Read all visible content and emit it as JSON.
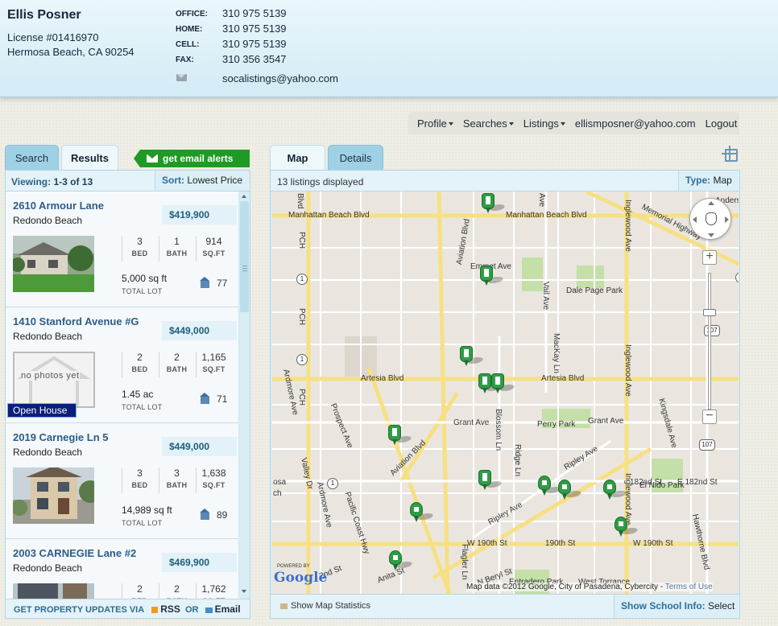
{
  "header": {
    "agent_name": "Ellis Posner",
    "license": "License #01416970",
    "location": "Hermosa Beach, CA 90254",
    "contacts": [
      {
        "label": "OFFICE:",
        "value": "310 975 5139"
      },
      {
        "label": "HOME:",
        "value": "310 975 5139"
      },
      {
        "label": "CELL:",
        "value": "310 975 5139"
      },
      {
        "label": "FAX:",
        "value": "310 356 3547"
      }
    ],
    "email": "socalistings@yahoo.com"
  },
  "nav": {
    "profile": "Profile",
    "searches": "Searches",
    "listings": "Listings",
    "user_email": "ellismposner@yahoo.com",
    "logout": "Logout"
  },
  "left_tabs": {
    "search": "Search",
    "results": "Results"
  },
  "alerts_button": "get email alerts",
  "results": {
    "viewing_label": "Viewing:",
    "viewing_range": "1-3 of 13",
    "sort_label": "Sort:",
    "sort_value": "Lowest Price",
    "bed_label": "BED",
    "bath_label": "BATH",
    "sqft_label": "SQ.FT",
    "lot_label": "TOTAL LOT",
    "no_photo": "no photos yet",
    "open_house": "Open House",
    "items": [
      {
        "address": "2610 Armour Lane",
        "city": "Redondo Beach",
        "price": "$419,900",
        "beds": "3",
        "baths": "1",
        "sqft": "914",
        "lot": "5,000 sq ft",
        "school": "77"
      },
      {
        "address": "1410 Stanford Avenue #G",
        "city": "Redondo Beach",
        "price": "$449,000",
        "beds": "2",
        "baths": "2",
        "sqft": "1,165",
        "lot": "1.45 ac",
        "school": "71"
      },
      {
        "address": "2019 Carnegie Ln 5",
        "city": "Redondo Beach",
        "price": "$449,000",
        "beds": "3",
        "baths": "3",
        "sqft": "1,638",
        "lot": "14,989 sq ft",
        "school": "89"
      },
      {
        "address": "2003 CARNEGIE Lane #2",
        "city": "Redondo Beach",
        "price": "$469,900",
        "beds": "2",
        "baths": "2",
        "sqft": "1,762",
        "lot": "",
        "school": ""
      }
    ],
    "footer": {
      "updates": "GET PROPERTY UPDATES VIA",
      "rss": "RSS",
      "or": "OR",
      "email": "Email"
    }
  },
  "right_tabs": {
    "map": "Map",
    "details": "Details"
  },
  "map_panel": {
    "listings_count": "13 listings displayed",
    "type_label": "Type:",
    "type_value": "Map",
    "attribution": "Map data ©2012 Google, City of Pasadena, Cybercity -",
    "terms": "Terms of Use",
    "powered": "POWERED BY",
    "google": "Google",
    "stats_link": "Show Map Statistics",
    "school_label": "Show School Info:",
    "school_value": "Select",
    "streets": {
      "manhattan": "Manhattan Beach Blvd",
      "manhattan2": "Manhattan Beach Blvd",
      "artesia": "Artesia Blvd",
      "artesia2": "Artesia Blvd",
      "grant": "Grant Ave",
      "grant2": "Grant Ave",
      "ripley": "Ripley Ave",
      "ripley2": "Ripley Ave",
      "w190": "W 190th St",
      "190": "190th St",
      "w190b": "W 190th St",
      "182": "182nd St",
      "e182": "E 182nd St",
      "aviation": "Aviation Blvd",
      "aviation2": "Aviation Blvd",
      "inglewood": "Inglewood Ave",
      "inglewood2": "Inglewood Ave",
      "inglewood3": "Inglewood Ave",
      "prospect": "Prospect Ave",
      "pch": "PCH",
      "pch2": "PCH",
      "pch3": "PCH",
      "pacific": "Pacific Coast Hwy",
      "ardmore": "Ardmore Ave",
      "ardmore2": "Ardmore Ave",
      "valley": "Valley Dr",
      "blossom": "Blossom Ln",
      "ridge": "Ridge Ln",
      "mackay": "MacKay Ln",
      "vail": "Vail Ave",
      "kingsdale": "Kingsdale Ave",
      "hawthorne": "Hawthorne Blvd",
      "flagler": "Flagler Ln",
      "nberyl": "N Beryl St",
      "anita": "Anita St",
      "2nd": "2nd St",
      "emmet": "Emmet Ave",
      "memorial": "Memorial Highway",
      "anders": "Anders",
      "blvd": "Blvd",
      "ave": "Ave",
      "osa": "osa",
      "ch": "ch",
      "dale_page": "Dale Page Park",
      "perry": "Perry Park",
      "elnido": "El Nido Park",
      "entradero": "Entradero Park",
      "west_torrance": "West Torrance"
    },
    "routes": [
      "1",
      "1",
      "1",
      "107",
      "107",
      "1"
    ]
  },
  "colors": {
    "header_bg": "#d3ebf5",
    "accent_blue": "#2c5c8a",
    "tab_active": "#eef8fb",
    "tab_inactive": "#9fd0e6",
    "alerts_green": "#1f9a24",
    "marker_green": "#2f9c46",
    "open_house_bg": "#0a1e7a",
    "map_road_major": "#f7e082"
  }
}
